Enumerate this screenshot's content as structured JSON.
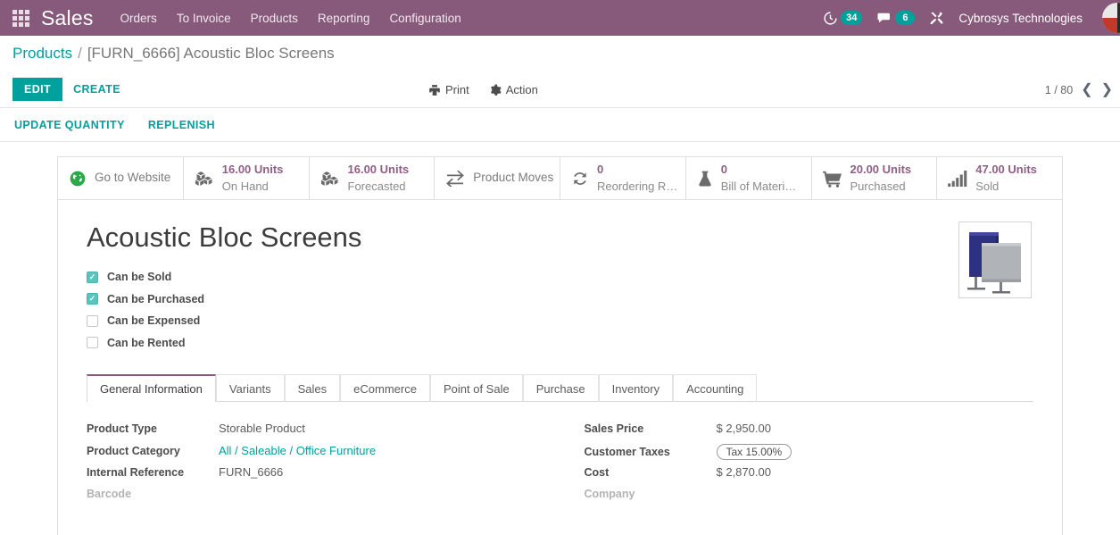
{
  "navbar": {
    "apps_icon": "apps-grid-icon",
    "brand": "Sales",
    "menu": [
      {
        "label": "Orders"
      },
      {
        "label": "To Invoice"
      },
      {
        "label": "Products"
      },
      {
        "label": "Reporting"
      },
      {
        "label": "Configuration"
      }
    ],
    "activities": {
      "icon": "clock-icon",
      "count": "34"
    },
    "messages": {
      "icon": "chat-bubble-icon",
      "count": "6"
    },
    "debug": {
      "icon": "tools-icon"
    },
    "username": "Cybrosys Technologies",
    "avatar": "user-avatar"
  },
  "breadcrumb": {
    "parent": "Products",
    "separator": "/",
    "current": "[FURN_6666] Acoustic Bloc Screens"
  },
  "control_panel": {
    "edit_label": "EDIT",
    "create_label": "CREATE",
    "print_label": "Print",
    "print_icon": "printer-icon",
    "action_label": "Action",
    "action_icon": "gear-icon",
    "pager_text": "1 / 80",
    "prev_icon": "chevron-left-icon",
    "next_icon": "chevron-right-icon"
  },
  "sub_bar": {
    "buttons": [
      {
        "label": "UPDATE QUANTITY"
      },
      {
        "label": "REPLENISH"
      }
    ]
  },
  "stat_buttons": [
    {
      "icon": "globe-icon",
      "value": "",
      "label": "Go to Website",
      "single": true
    },
    {
      "icon": "boxes-icon",
      "value": "16.00 Units",
      "label": "On Hand",
      "single": false
    },
    {
      "icon": "boxes-icon",
      "value": "16.00 Units",
      "label": "Forecasted",
      "single": false
    },
    {
      "icon": "exchange-arrows-icon",
      "value": "",
      "label": "Product Moves",
      "single": true
    },
    {
      "icon": "refresh-icon",
      "value": "0",
      "label": "Reordering R…",
      "single": false
    },
    {
      "icon": "flask-icon",
      "value": "0",
      "label": "Bill of Materi…",
      "single": false
    },
    {
      "icon": "shopping-cart-icon",
      "value": "20.00 Units",
      "label": "Purchased",
      "single": false
    },
    {
      "icon": "bar-chart-icon",
      "value": "47.00 Units",
      "label": "Sold",
      "single": false
    }
  ],
  "product": {
    "title": "Acoustic Bloc Screens",
    "image_alt": "acoustic-bloc-screens-photo",
    "checkboxes": [
      {
        "label": "Can be Sold",
        "checked": true
      },
      {
        "label": "Can be Purchased",
        "checked": true
      },
      {
        "label": "Can be Expensed",
        "checked": false
      },
      {
        "label": "Can be Rented",
        "checked": false
      }
    ]
  },
  "tabs": [
    {
      "label": "General Information",
      "active": true
    },
    {
      "label": "Variants",
      "active": false
    },
    {
      "label": "Sales",
      "active": false
    },
    {
      "label": "eCommerce",
      "active": false
    },
    {
      "label": "Point of Sale",
      "active": false
    },
    {
      "label": "Purchase",
      "active": false
    },
    {
      "label": "Inventory",
      "active": false
    },
    {
      "label": "Accounting",
      "active": false
    }
  ],
  "form": {
    "left": [
      {
        "label": "Product Type",
        "value": "Storable Product",
        "kind": "text"
      },
      {
        "label": "Product Category",
        "value": "All / Saleable / Office Furniture",
        "kind": "link"
      },
      {
        "label": "Internal Reference",
        "value": "FURN_6666",
        "kind": "text"
      },
      {
        "label": "Barcode",
        "value": "",
        "kind": "empty"
      }
    ],
    "right": [
      {
        "label": "Sales Price",
        "value": "$ 2,950.00",
        "kind": "text"
      },
      {
        "label": "Customer Taxes",
        "value": "Tax 15.00%",
        "kind": "badge"
      },
      {
        "label": "Cost",
        "value": "$ 2,870.00",
        "kind": "text"
      },
      {
        "label": "Company",
        "value": "",
        "kind": "empty"
      }
    ]
  },
  "colors": {
    "brand_purple": "#875A7B",
    "accent_teal": "#00A09D",
    "stat_value": "#8f5f84",
    "checkbox_on": "#5BC4BF"
  }
}
